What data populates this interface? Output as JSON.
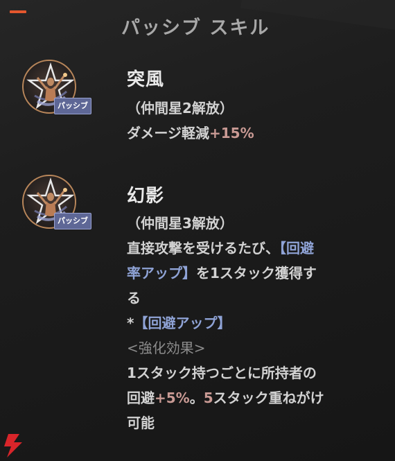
{
  "header": {
    "title": "パッシブ スキル"
  },
  "skills": [
    {
      "name": "突風",
      "badge": "パッシブ",
      "unlock": "（仲間星2解放）",
      "effect_prefix": "ダメージ軽減",
      "effect_value": "+15%"
    },
    {
      "name": "幻影",
      "badge": "パッシブ",
      "unlock": "（仲間星3解放）",
      "line1_text": "直接攻撃を受けるたび、",
      "line1_hl": "【回避",
      "line2_hl": "率アップ】",
      "line2_text": "を1スタック獲得す",
      "line3_text": "る",
      "note_star": "*",
      "note_hl": "【回避アップ】",
      "enhance_label": "<強化効果>",
      "line4_text": "1スタック持つごとに所持者の",
      "line5_text_a": "回避",
      "line5_pct": "+5%",
      "line5_text_b": "。",
      "line5_num": "5",
      "line5_text_c": "スタック重ねがけ",
      "line6_text": "可能"
    }
  ],
  "colors": {
    "accent": "#e4572e",
    "badge": "#5e6796",
    "highlight_pct": "#c99a94",
    "highlight_blue": "#8fa3d6"
  },
  "icons": {
    "skill_icon": "dancer-star-medal-icon",
    "logo": "lightning-logo-icon"
  }
}
